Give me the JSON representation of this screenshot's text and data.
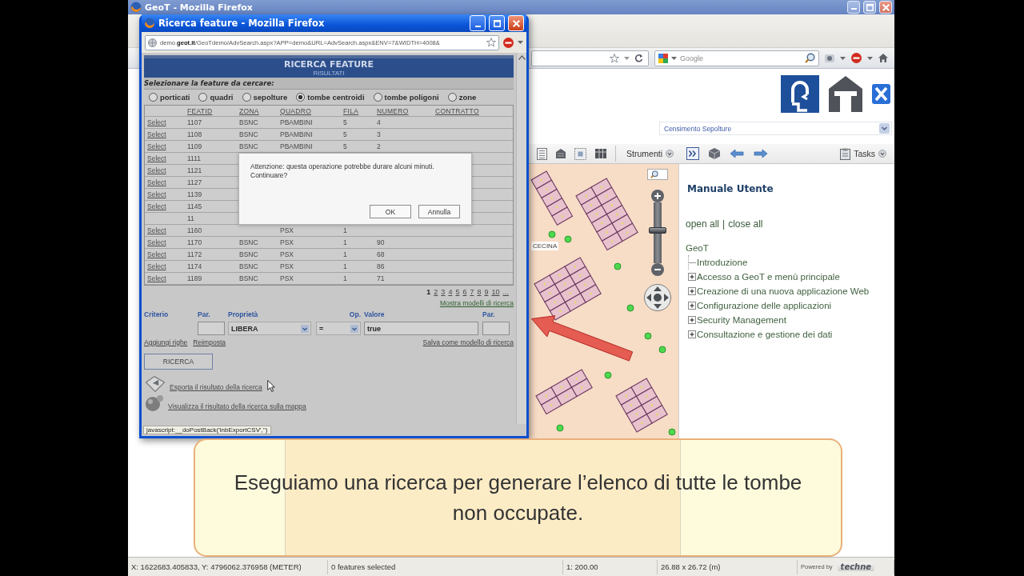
{
  "main_window": {
    "title": "GeoT - Mozilla Firefox",
    "search": {
      "placeholder": "Google"
    }
  },
  "popup": {
    "title": "Ricerca feature - Mozilla Firefox",
    "url": "demo.**geot.it**/GeoTdemo/AdvSearch.aspx?APP=demo&URL=AdvSearch.aspx&ENV=7&WIDTH=4008&",
    "header": {
      "title": "RICERCA FEATURE",
      "subtitle": "RISULTATI"
    },
    "prompt": "Selezionare la feature da cercare:",
    "features": [
      {
        "label": "porticati",
        "selected": false
      },
      {
        "label": "quadri",
        "selected": false
      },
      {
        "label": "sepolture",
        "selected": false
      },
      {
        "label": "tombe centroidi",
        "selected": true
      },
      {
        "label": "tombe poligoni",
        "selected": false
      },
      {
        "label": "zone",
        "selected": false
      }
    ],
    "results": {
      "columns": [
        "FEATID",
        "ZONA",
        "QUADRO",
        "FILA",
        "NUMERO",
        "CONTRATTO"
      ],
      "rows": [
        {
          "select": "Select",
          "featid": "1107",
          "zona": "BSNC",
          "quadro": "PBAMBINI",
          "fila": "5",
          "numero": "4"
        },
        {
          "select": "Select",
          "featid": "1108",
          "zona": "BSNC",
          "quadro": "PBAMBINI",
          "fila": "5",
          "numero": "3"
        },
        {
          "select": "Select",
          "featid": "1109",
          "zona": "BSNC",
          "quadro": "PBAMBINI",
          "fila": "5",
          "numero": "2"
        },
        {
          "select": "Select",
          "featid": "1111"
        },
        {
          "select": "Select",
          "featid": "1121"
        },
        {
          "select": "Select",
          "featid": "1127"
        },
        {
          "select": "Select",
          "featid": "1139"
        },
        {
          "select": "Select",
          "featid": "1145"
        },
        {
          "featid": "11"
        },
        {
          "select": "Select",
          "featid": "1160",
          "quadro": "PSX",
          "fila": "1"
        },
        {
          "select": "Select",
          "featid": "1170",
          "zona": "BSNC",
          "quadro": "PSX",
          "fila": "1",
          "numero": "90"
        },
        {
          "select": "Select",
          "featid": "1172",
          "zona": "BSNC",
          "quadro": "PSX",
          "fila": "1",
          "numero": "68"
        },
        {
          "select": "Select",
          "featid": "1174",
          "zona": "BSNC",
          "quadro": "PSX",
          "fila": "1",
          "numero": "86"
        },
        {
          "select": "Select",
          "featid": "1189",
          "zona": "BSNC",
          "quadro": "PSX",
          "fila": "1",
          "numero": "71"
        }
      ]
    },
    "pages": [
      {
        "label": "1",
        "selected": true
      },
      {
        "label": "2",
        "selected": false
      },
      {
        "label": "3",
        "selected": false
      },
      {
        "label": "4",
        "selected": false
      },
      {
        "label": "5",
        "selected": false
      },
      {
        "label": "6",
        "selected": false
      },
      {
        "label": "7",
        "selected": false
      },
      {
        "label": "8",
        "selected": false
      },
      {
        "label": "9",
        "selected": false
      },
      {
        "label": "10",
        "selected": false
      },
      {
        "label": "...",
        "selected": false
      }
    ],
    "criteria": {
      "models_link": "Mostra modelli di ricerca",
      "columns": [
        "Criterio",
        "Par.",
        "Proprietà",
        "Op.",
        "Valore",
        "Par."
      ],
      "property": "LIBERA",
      "operator": "=",
      "value": "true",
      "links": [
        "Aggiungi righe",
        "Reimposta"
      ],
      "save_link": "Salva come modello di ricerca"
    },
    "search_button": "RICERCA",
    "exports": [
      {
        "kind": "export",
        "label": "Esporta il risultato della ricerca"
      },
      {
        "kind": "map",
        "label": "Visualizza il risultato della ricerca sulla mappa"
      }
    ],
    "status": "javascript:__doPostBack('lnbExportCSV','')",
    "dialog": {
      "message": [
        "Attenzione: questa operazione potrebbe durare alcuni minuti.",
        "Continuare?"
      ],
      "buttons": [
        "OK",
        "Annulla"
      ]
    }
  },
  "app": {
    "project_select": "Censimento Sepolture",
    "tools_menu": "Strumenti",
    "tasks_menu": "Tasks",
    "map": {
      "place_label": "CECINA",
      "zoom": {
        "level": 0.55
      }
    },
    "manual": {
      "title": "Manuale Utente",
      "open_all": "open all",
      "separator": "|",
      "close_all": "close all",
      "tree": [
        {
          "label": "GeoT",
          "children": [
            {
              "label": "Introduzione",
              "kind": "page"
            },
            {
              "label": "Accesso a GeoT e menù principale",
              "kind": "section",
              "expanded": false
            },
            {
              "label": "Creazione di una nuova applicazione Web",
              "kind": "section",
              "expanded": false
            },
            {
              "label": "Configurazione delle applicazioni",
              "kind": "section",
              "expanded": false
            },
            {
              "label": "Security Management",
              "kind": "section",
              "expanded": false
            },
            {
              "label": "Consultazione e gestione dei dati",
              "kind": "section",
              "expanded": false
            }
          ]
        }
      ]
    }
  },
  "caption": "Eseguiamo una ricerca per generare l’elenco di tutte le tombe non occupate.",
  "status_bar": {
    "coordinates": "X: 1622683.405833, Y: 4796062.376958 (METER)",
    "selection": "0 features selected",
    "scale": "1: 200.00",
    "extent": "26.88 x 26.72 (m)",
    "powered_by": "Powered by",
    "brand": "techne"
  }
}
